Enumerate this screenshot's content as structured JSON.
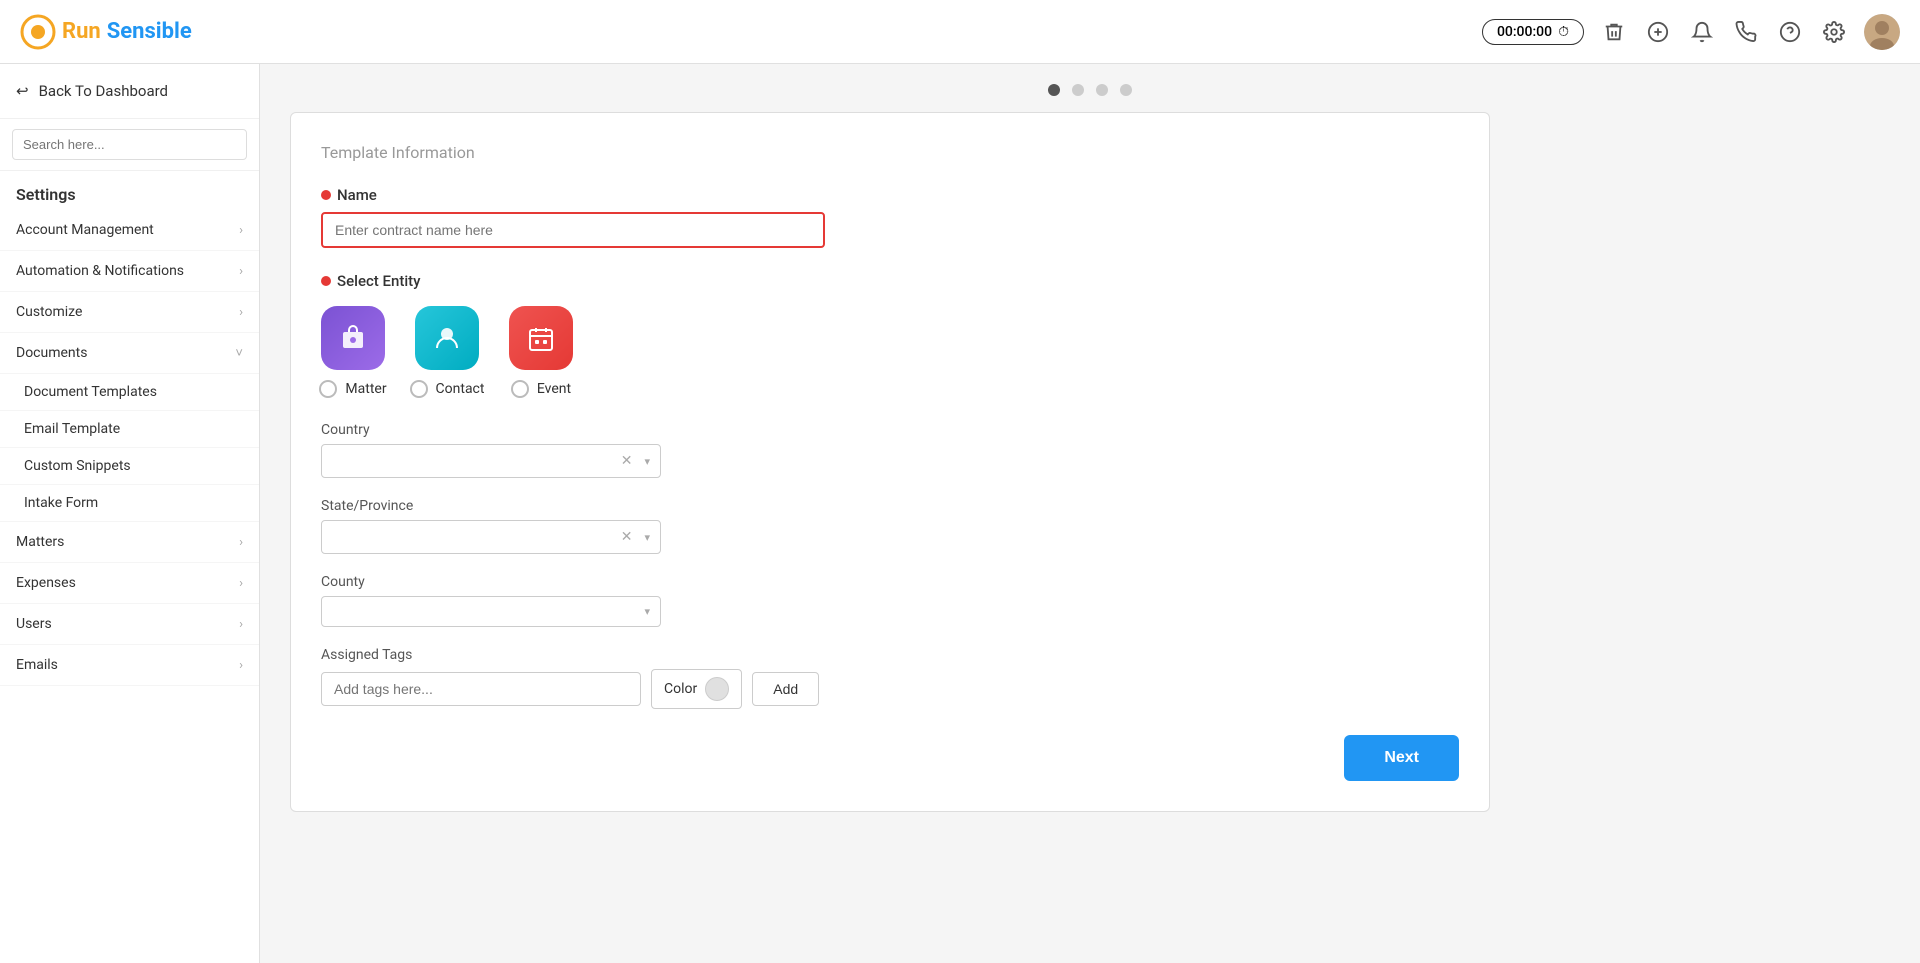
{
  "header": {
    "logo_run": "Run",
    "logo_sensible": "Sensible",
    "timer": "00:00:00",
    "avatar_initial": "👤"
  },
  "sidebar": {
    "back_label": "Back To Dashboard",
    "search_placeholder": "Search here...",
    "settings_title": "Settings",
    "items": [
      {
        "id": "account-management",
        "label": "Account Management",
        "has_chevron": true,
        "expanded": false
      },
      {
        "id": "automation-notifications",
        "label": "Automation & Notifications",
        "has_chevron": true,
        "expanded": false
      },
      {
        "id": "customize",
        "label": "Customize",
        "has_chevron": true,
        "expanded": false
      },
      {
        "id": "documents",
        "label": "Documents",
        "has_chevron": true,
        "expanded": true
      },
      {
        "id": "document-templates",
        "label": "Document Templates",
        "sub": true
      },
      {
        "id": "email-template",
        "label": "Email Template",
        "sub": true
      },
      {
        "id": "custom-snippets",
        "label": "Custom Snippets",
        "sub": true
      },
      {
        "id": "intake-form",
        "label": "Intake Form",
        "sub": true
      },
      {
        "id": "matters",
        "label": "Matters",
        "has_chevron": true
      },
      {
        "id": "expenses",
        "label": "Expenses",
        "has_chevron": true
      },
      {
        "id": "users",
        "label": "Users",
        "has_chevron": true
      },
      {
        "id": "emails",
        "label": "Emails",
        "has_chevron": true
      }
    ]
  },
  "steps": {
    "dots": [
      {
        "id": "step1",
        "active": true
      },
      {
        "id": "step2",
        "active": false
      },
      {
        "id": "step3",
        "active": false
      },
      {
        "id": "step4",
        "active": false
      }
    ]
  },
  "form": {
    "section_title": "Template Information",
    "name_label": "Name",
    "name_placeholder": "Enter contract name here",
    "entity_label": "Select Entity",
    "entities": [
      {
        "id": "matter",
        "label": "Matter",
        "icon": "💼",
        "bg_class": "entity-icon-matter"
      },
      {
        "id": "contact",
        "label": "Contact",
        "icon": "👤",
        "bg_class": "entity-icon-contact"
      },
      {
        "id": "event",
        "label": "Event",
        "icon": "📅",
        "bg_class": "entity-icon-event"
      }
    ],
    "country_label": "Country",
    "country_placeholder": "",
    "state_label": "State/Province",
    "state_placeholder": "",
    "county_label": "County",
    "county_placeholder": "",
    "tags_label": "Assigned Tags",
    "tags_placeholder": "Add tags here...",
    "color_label": "Color",
    "add_label": "Add"
  },
  "footer": {
    "next_label": "Next"
  }
}
